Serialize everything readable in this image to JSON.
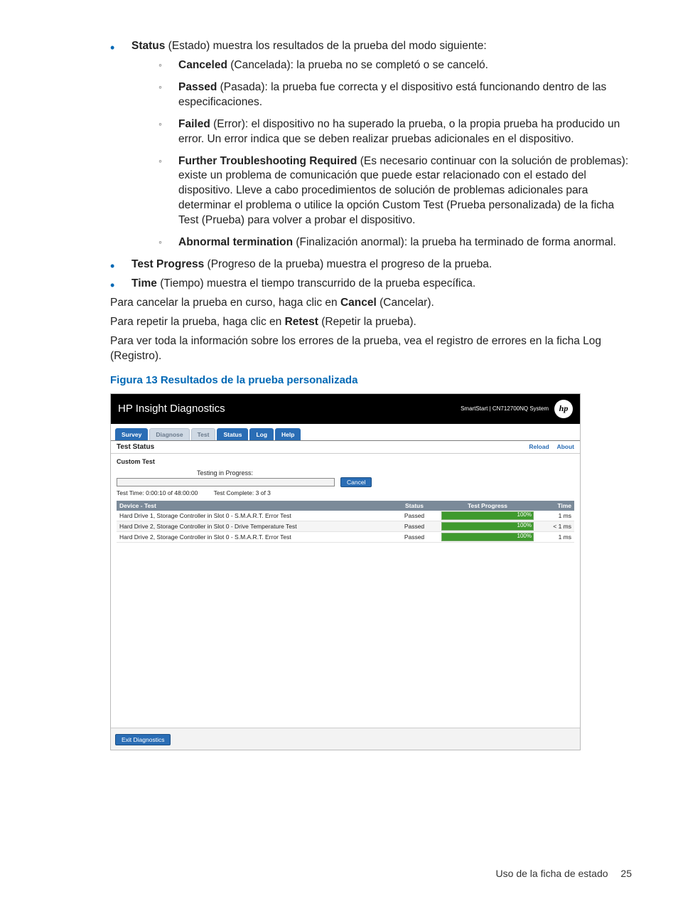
{
  "bullets_top": {
    "status_intro": {
      "bold": "Status",
      "rest": " (Estado) muestra los resultados de la prueba del modo siguiente:"
    },
    "sub": [
      {
        "bold": "Canceled",
        "rest": " (Cancelada): la prueba no se completó o se canceló."
      },
      {
        "bold": "Passed",
        "rest": " (Pasada): la prueba fue correcta y el dispositivo está funcionando dentro de las especificaciones."
      },
      {
        "bold": "Failed",
        "rest": " (Error): el dispositivo no ha superado la prueba, o la propia prueba ha producido un error. Un error indica que se deben realizar pruebas adicionales en el dispositivo."
      },
      {
        "bold": "Further Troubleshooting Required",
        "rest": " (Es necesario continuar con la solución de problemas): existe un problema de comunicación que puede estar relacionado con el estado del dispositivo. Lleve a cabo procedimientos de solución de problemas adicionales para determinar el problema o utilice la opción Custom Test (Prueba personalizada) de la ficha Test (Prueba) para volver a probar el dispositivo."
      },
      {
        "bold": "Abnormal termination",
        "rest": " (Finalización anormal): la prueba ha terminado de forma anormal."
      }
    ],
    "progress": {
      "bold": "Test Progress",
      "rest": " (Progreso de la prueba) muestra el progreso de la prueba."
    },
    "time": {
      "bold": "Time",
      "rest": " (Tiempo) muestra el tiempo transcurrido de la prueba específica."
    }
  },
  "paras": {
    "p1a": "Para cancelar la prueba en curso, haga clic en ",
    "p1b": "Cancel",
    "p1c": " (Cancelar).",
    "p2a": "Para repetir la prueba, haga clic en ",
    "p2b": "Retest",
    "p2c": " (Repetir la prueba).",
    "p3": "Para ver toda la información sobre los errores de la prueba, vea el registro de errores en la ficha Log (Registro)."
  },
  "figure_caption": "Figura 13 Resultados de la prueba personalizada",
  "screenshot": {
    "app_title": "HP Insight Diagnostics",
    "system_label": "SmartStart | CN712700NQ System",
    "logo_text": "hp",
    "tabs": [
      {
        "label": "Survey",
        "active": true
      },
      {
        "label": "Diagnose",
        "active": false
      },
      {
        "label": "Test",
        "active": false
      },
      {
        "label": "Status",
        "active": true
      },
      {
        "label": "Log",
        "active": true
      },
      {
        "label": "Help",
        "active": true
      }
    ],
    "section_title": "Test Status",
    "links": {
      "reload": "Reload",
      "about": "About"
    },
    "subhead": "Custom Test",
    "progress_label": "Testing in Progress:",
    "cancel_label": "Cancel",
    "meta": {
      "time_label": "Test Time: 0:00:10 of 48:00:00",
      "complete_label": "Test Complete: 3 of 3"
    },
    "table": {
      "headers": {
        "device": "Device - Test",
        "status": "Status",
        "progress": "Test Progress",
        "time": "Time"
      },
      "rows": [
        {
          "device": "Hard Drive 1, Storage Controller in Slot 0 - S.M.A.R.T. Error Test",
          "status": "Passed",
          "pct": 100,
          "pct_label": "100%",
          "time": "1 ms"
        },
        {
          "device": "Hard Drive 2, Storage Controller in Slot 0 - Drive Temperature Test",
          "status": "Passed",
          "pct": 100,
          "pct_label": "100%",
          "time": "< 1 ms"
        },
        {
          "device": "Hard Drive 2, Storage Controller in Slot 0 - S.M.A.R.T. Error Test",
          "status": "Passed",
          "pct": 100,
          "pct_label": "100%",
          "time": "1 ms"
        }
      ]
    },
    "exit_label": "Exit Diagnostics"
  },
  "footer": {
    "text": "Uso de la ficha de estado",
    "page": "25"
  }
}
